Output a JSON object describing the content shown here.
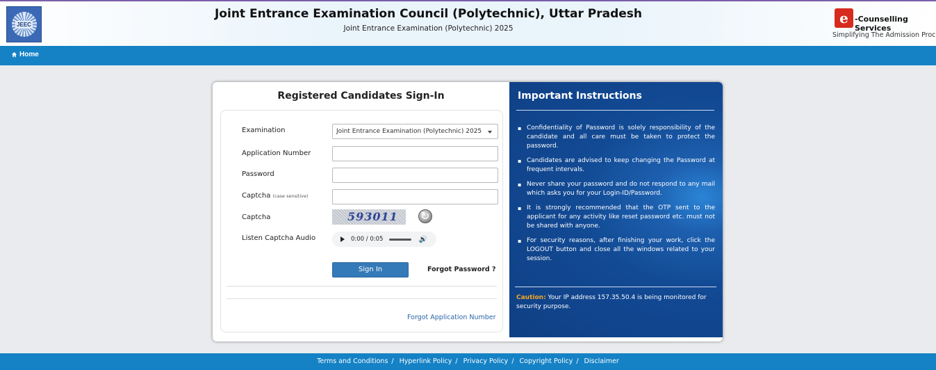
{
  "header": {
    "title": "Joint Entrance Examination Council (Polytechnic), Uttar Pradesh",
    "subtitle": "Joint Entrance Examination (Polytechnic) 2025",
    "brand_name": "-Counselling Services",
    "brand_letter": "e",
    "brand_tagline": "Simplifying The Admission Process"
  },
  "nav": {
    "home": "Home"
  },
  "signin": {
    "title": "Registered Candidates Sign-In",
    "exam_label": "Examination",
    "exam_value": "Joint Entrance Examination (Polytechnic) 2025",
    "appno_label": "Application Number",
    "appno_value": "",
    "password_label": "Password",
    "password_value": "",
    "captcha_input_label": "Captcha",
    "captcha_hint": "(case sensitive)",
    "captcha_value": "",
    "captcha_image_label": "Captcha",
    "captcha_text": "593011",
    "audio_label": "Listen Captcha Audio",
    "audio_time": "0:00 / 0:05",
    "signin_button": "Sign In",
    "forgot_password": "Forgot Password ?",
    "forgot_application": "Forgot Application Number"
  },
  "instructions": {
    "title": "Important Instructions",
    "items": [
      "Confidentiality of Password is solely responsibility of the candidate and all care must be taken to protect the password.",
      "Candidates are advised to keep changing the Password at frequent intervals.",
      "Never share your password and do not respond to any mail which asks you for your Login-ID/Password.",
      "It is strongly recommended that the OTP sent to the applicant for any activity like reset password etc. must not be shared with anyone.",
      "For security reasons, after finishing your work, click the LOGOUT button and close all the windows related to your session."
    ],
    "caution_label": "Caution:",
    "caution_text": "Your IP address 157.35.50.4 is being monitored for security purpose."
  },
  "footer": {
    "links": [
      "Terms and Conditions",
      "Hyperlink Policy",
      "Privacy Policy",
      "Copyright Policy",
      "Disclaimer"
    ]
  },
  "colors": {
    "nav_blue": "#1582c5",
    "button_blue": "#3479b8",
    "panel_blue": "#124a94",
    "caution_orange": "#f5a623"
  }
}
